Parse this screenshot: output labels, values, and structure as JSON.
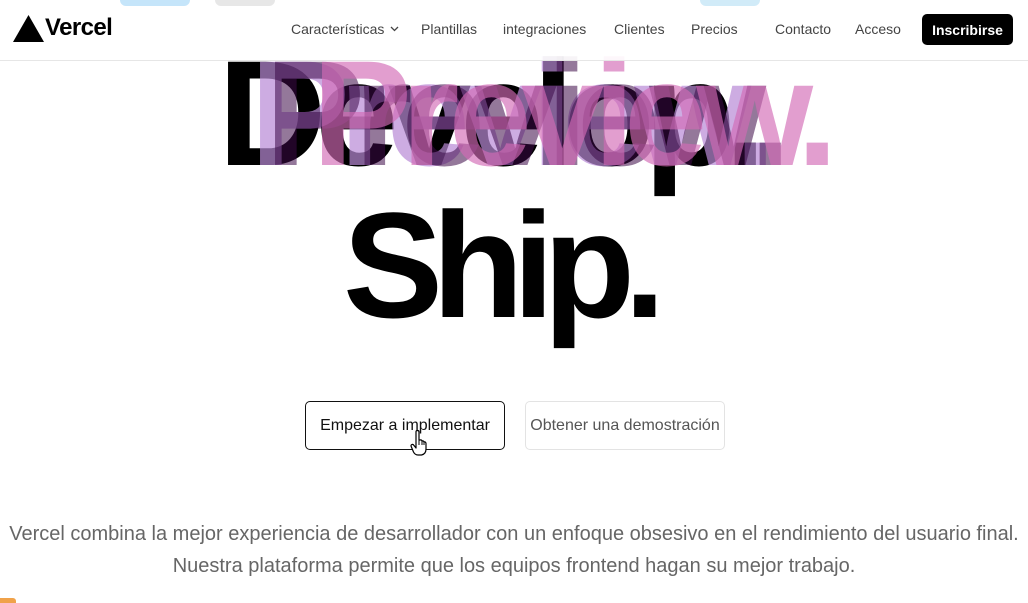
{
  "header": {
    "logo_text": "Vercel",
    "nav": {
      "features": "Características",
      "templates": "Plantillas",
      "integrations": "integraciones",
      "customers": "Clientes",
      "pricing": "Precios",
      "contact": "Contacto",
      "login": "Acceso"
    },
    "signup_label": "Inscribirse"
  },
  "hero": {
    "word_develop": "Develop.",
    "word_preview": "Preview.",
    "word_ship": "Ship."
  },
  "actions": {
    "primary_label": "Empezar a implementar",
    "secondary_label": "Obtener una demostración"
  },
  "description": {
    "line1": "Vercel combina la mejor experiencia de desarrollador con un enfoque obsesivo en el rendimiento del usuario final.",
    "line2": "Nuestra plataforma permite que los equipos frontend hagan su mejor trabajo."
  },
  "colors": {
    "accent_black": "#000000",
    "preview_purple": "#b98ad6",
    "preview_pink": "#d36bb6"
  },
  "icons": [
    "vercel-triangle-icon",
    "chevron-down-icon",
    "hand-pointer-cursor-icon"
  ]
}
